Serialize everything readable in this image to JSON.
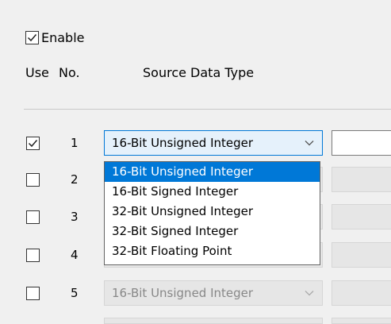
{
  "enable": {
    "label": "Enable",
    "checked": true
  },
  "headers": {
    "use": "Use",
    "no": "No.",
    "source_type": "Source Data Type"
  },
  "rows": [
    {
      "num": "1",
      "checked": true,
      "type": "16-Bit Unsigned Integer",
      "active": true
    },
    {
      "num": "2",
      "checked": false,
      "type": "",
      "active": false
    },
    {
      "num": "3",
      "checked": false,
      "type": "",
      "active": false
    },
    {
      "num": "4",
      "checked": false,
      "type": "",
      "active": false
    },
    {
      "num": "5",
      "checked": false,
      "type": "16-Bit Unsigned Integer",
      "active": false
    }
  ],
  "dropdown": {
    "options": [
      "16-Bit Unsigned Integer",
      "16-Bit Signed Integer",
      "32-Bit Unsigned Integer",
      "32-Bit Signed Integer",
      "32-Bit Floating Point"
    ],
    "selected": "16-Bit Unsigned Integer"
  },
  "colors": {
    "accent": "#0078d7",
    "disabled_bg": "#e6e6e6",
    "combo_active_bg": "#e5f1fb"
  },
  "icons": {
    "check": "check-icon",
    "chevron": "chevron-down-icon"
  }
}
